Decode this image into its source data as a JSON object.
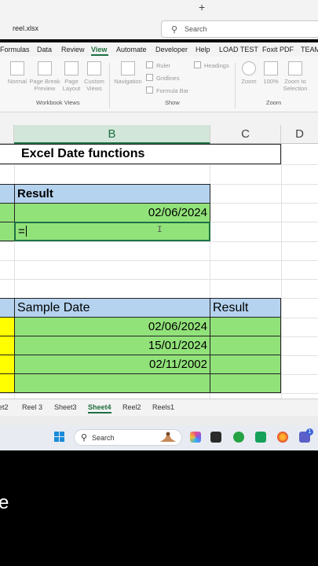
{
  "window": {
    "filename": "reel.xlsx",
    "search_placeholder": "Search"
  },
  "ribbon": {
    "tabs": [
      {
        "label": "Formulas"
      },
      {
        "label": "Data"
      },
      {
        "label": "Review"
      },
      {
        "label": "View",
        "active": true
      },
      {
        "label": "Automate"
      },
      {
        "label": "Developer"
      },
      {
        "label": "Help"
      },
      {
        "label": "LOAD TEST"
      },
      {
        "label": "Foxit PDF"
      },
      {
        "label": "TEAM"
      }
    ],
    "workbook_views": {
      "group_label": "Workbook Views",
      "normal": "Normal",
      "page_break_1": "Page Break",
      "page_break_2": "Preview",
      "page_layout_1": "Page",
      "page_layout_2": "Layout",
      "custom_1": "Custom",
      "custom_2": "Views"
    },
    "show": {
      "group_label": "Show",
      "navigation": "Navigation",
      "ruler": "Ruler",
      "gridlines": "Gridlines",
      "formula_bar": "Formula Bar",
      "headings": "Headings"
    },
    "zoom": {
      "group_label": "Zoom",
      "zoom": "Zoom",
      "hundred": "100%",
      "zoom_sel_1": "Zoom to",
      "zoom_sel_2": "Selection"
    }
  },
  "grid": {
    "columns": [
      "B",
      "C",
      "D"
    ],
    "title": "Excel Date functions",
    "table1": {
      "header": "Result",
      "row1": "02/06/2024",
      "row2": "="
    },
    "table2": {
      "headers": [
        "Sample Date",
        "Result"
      ],
      "rows": [
        "02/06/2024",
        "15/01/2024",
        "02/11/2002",
        ""
      ]
    },
    "cursor": "I"
  },
  "sheets": {
    "tabs": [
      {
        "label": "et2"
      },
      {
        "label": "Reel 3"
      },
      {
        "label": "Sheet3"
      },
      {
        "label": "Sheet4",
        "active": true
      },
      {
        "label": "Reel2"
      },
      {
        "label": "Reels1"
      }
    ],
    "add": "+"
  },
  "taskbar": {
    "search_placeholder": "Search",
    "badge": "1"
  },
  "overlay": {
    "edge_text": "e"
  },
  "colors": {
    "excel_green": "#217346",
    "header_blue": "#b5d3ef",
    "cell_green": "#92e27a",
    "cell_yellow": "#ffff00"
  }
}
